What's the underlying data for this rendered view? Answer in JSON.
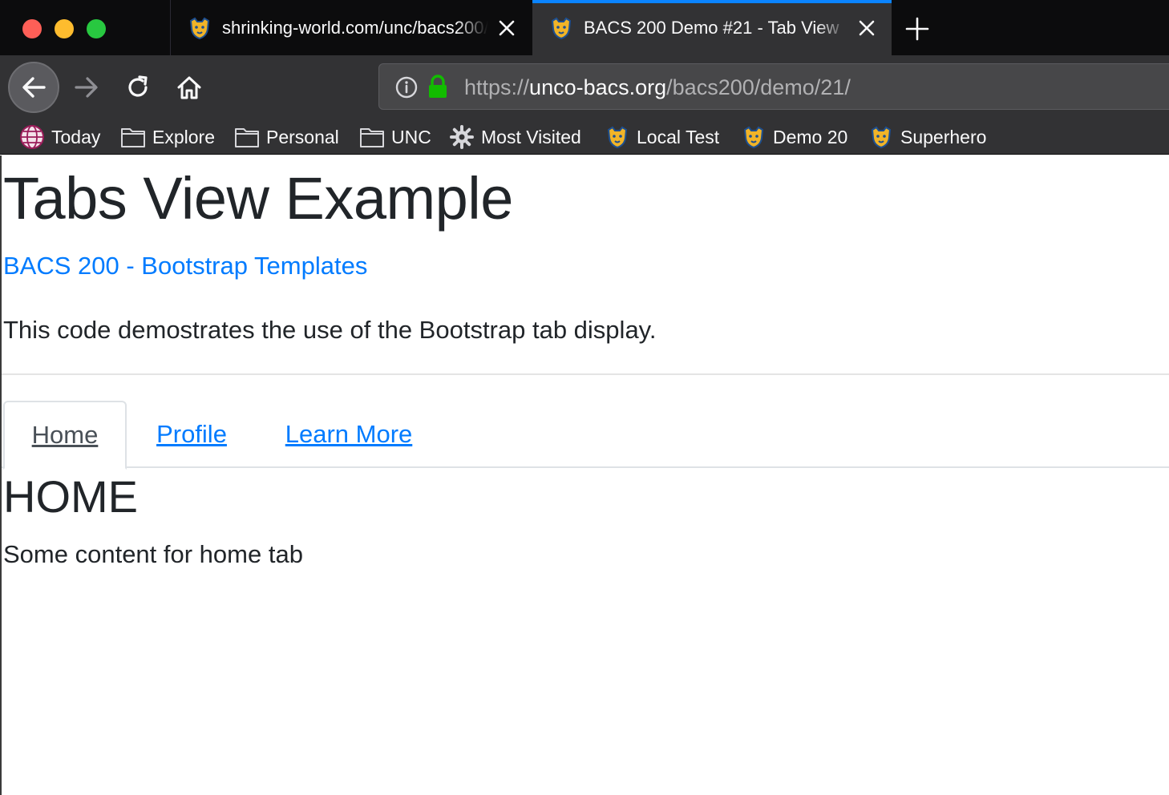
{
  "browser": {
    "tabs": [
      {
        "title": "shrinking-world.com/unc/bacs200/",
        "active": false
      },
      {
        "title": "BACS 200 Demo #21 - Tab View",
        "active": true
      }
    ],
    "address_bar": {
      "protocol": "https://",
      "host": "unco-bacs.org",
      "path": "/bacs200/demo/21/"
    },
    "bookmarks": [
      {
        "label": "Today",
        "icon": "globe-icon"
      },
      {
        "label": "Explore",
        "icon": "folder-icon"
      },
      {
        "label": "Personal",
        "icon": "folder-icon"
      },
      {
        "label": "UNC",
        "icon": "folder-icon"
      },
      {
        "label": "Most Visited",
        "icon": "gear-icon"
      },
      {
        "label": "Local Test",
        "icon": "bear-favicon-icon"
      },
      {
        "label": "Demo 20",
        "icon": "bear-favicon-icon"
      },
      {
        "label": "Superhero",
        "icon": "bear-favicon-icon"
      }
    ],
    "colors": {
      "active_tab_accent": "#0a84ff",
      "lock_green": "#12bc00"
    }
  },
  "page": {
    "title": "Tabs View Example",
    "link_text": "BACS 200 - Bootstrap Templates",
    "description": "This code demostrates the use of the Bootstrap tab display.",
    "tabs": [
      {
        "label": "Home",
        "active": true
      },
      {
        "label": "Profile",
        "active": false
      },
      {
        "label": "Learn More",
        "active": false
      }
    ],
    "pane": {
      "heading": "HOME",
      "text": "Some content for home tab"
    },
    "colors": {
      "link": "#007bff",
      "text": "#212529"
    }
  }
}
